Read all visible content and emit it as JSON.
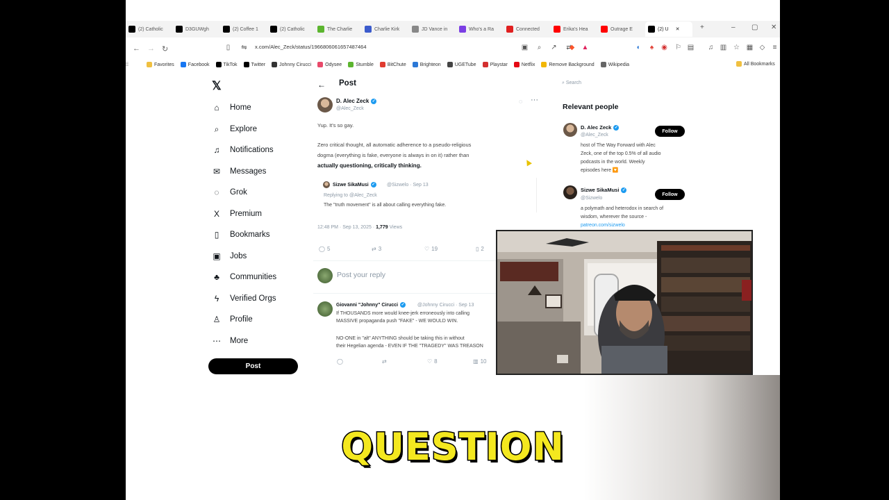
{
  "browser": {
    "tabs": [
      {
        "label": "(2) Catholic",
        "icon": "x-favicon",
        "color": "#000000"
      },
      {
        "label": "D3GUWgh",
        "icon": "x-favicon",
        "color": "#000000"
      },
      {
        "label": "(2) Coffee 1",
        "icon": "x-favicon",
        "color": "#000000"
      },
      {
        "label": "(2) Catholic",
        "icon": "x-favicon",
        "color": "#000000"
      },
      {
        "label": "The Charlie",
        "icon": "rumble-favicon",
        "color": "#5cb52f"
      },
      {
        "label": "Charlie Kirk",
        "icon": "shield-favicon",
        "color": "#3b5bcc"
      },
      {
        "label": "JD Vance in",
        "icon": "globe-favicon",
        "color": "#888888"
      },
      {
        "label": "Who's a Ra",
        "icon": "purple-favicon",
        "color": "#7b3fe4"
      },
      {
        "label": "Connected",
        "icon": "red-favicon",
        "color": "#e02020"
      },
      {
        "label": "Erika's Hea",
        "icon": "youtube-favicon",
        "color": "#ff0000"
      },
      {
        "label": "Outrage E",
        "icon": "youtube-favicon",
        "color": "#ff0000"
      },
      {
        "label": "(2) U",
        "icon": "x-favicon",
        "color": "#000000",
        "active": true
      }
    ],
    "url": "x.com/Alec_Zeck/status/1966806061657487464",
    "bookmarks": [
      {
        "label": "Favorites",
        "color": "#f0c040"
      },
      {
        "label": "Facebook",
        "color": "#1877f2"
      },
      {
        "label": "TikTok",
        "color": "#000000"
      },
      {
        "label": "Twitter",
        "color": "#000000"
      },
      {
        "label": "Johnny Cirucci",
        "color": "#333333"
      },
      {
        "label": "Odysee",
        "color": "#e84a6a"
      },
      {
        "label": "Stumble",
        "color": "#5cb52f"
      },
      {
        "label": "BitChute",
        "color": "#e03b2f"
      },
      {
        "label": "Brighteon",
        "color": "#2b78d6"
      },
      {
        "label": "UGETube",
        "color": "#444444"
      },
      {
        "label": "Playstar",
        "color": "#d32f2f"
      },
      {
        "label": "Netflix",
        "color": "#e50914"
      },
      {
        "label": "Remove Background",
        "color": "#f2b705"
      },
      {
        "label": "Wikipedia",
        "color": "#666666"
      }
    ],
    "all_bookmarks": "All Bookmarks"
  },
  "sidebar": {
    "items": [
      {
        "label": "Home",
        "icon": "home-icon",
        "glyph": "⌂"
      },
      {
        "label": "Explore",
        "icon": "search-icon",
        "glyph": "⌕"
      },
      {
        "label": "Notifications",
        "icon": "bell-icon",
        "glyph": "♫"
      },
      {
        "label": "Messages",
        "icon": "mail-icon",
        "glyph": "✉"
      },
      {
        "label": "Grok",
        "icon": "grok-icon",
        "glyph": "◌"
      },
      {
        "label": "Premium",
        "icon": "x-logo-icon",
        "glyph": "X"
      },
      {
        "label": "Bookmarks",
        "icon": "bookmark-icon",
        "glyph": "▯"
      },
      {
        "label": "Jobs",
        "icon": "briefcase-icon",
        "glyph": "▣"
      },
      {
        "label": "Communities",
        "icon": "people-icon",
        "glyph": "♣"
      },
      {
        "label": "Verified Orgs",
        "icon": "lightning-icon",
        "glyph": "ϟ"
      },
      {
        "label": "Profile",
        "icon": "person-icon",
        "glyph": "♙"
      },
      {
        "label": "More",
        "icon": "more-circle-icon",
        "glyph": "⋯"
      }
    ],
    "post_button": "Post"
  },
  "main": {
    "header": "Post",
    "tweet": {
      "author": "D. Alec Zeck",
      "handle": "@Alec_Zeck",
      "line1": "Yup. It's so gay.",
      "line2": "Zero critical thought, all automatic adherence to a pseudo-religious",
      "line3": "dogma (everything is fake, everyone is always in on it) rather than",
      "line4": "actually questioning, critically thinking.",
      "quoted": {
        "author": "Sizwe SikaMusi",
        "handle": "@Sizwelo · Sep 13",
        "replying": "Replying to @Alec_Zeck",
        "text": "The \"truth movement\" is all about calling everything fake."
      },
      "time": "12:48 PM",
      "date": "Sep 13, 2025",
      "views_count": "1,779",
      "views_label": "Views",
      "replies": "5",
      "reposts": "3",
      "likes": "19",
      "bookmarks": "2"
    },
    "reply_placeholder": "Post your reply",
    "reply": {
      "author": "Giovanni \"Johnny\" Cirucci",
      "handle": "@Johnny Cirucci · Sep 13",
      "line1": "If THOUSANDS more would knee-jerk erroneously into calling",
      "line2": "MASSIVE propaganda push \"FAKE\" - WE WOULD WIN.",
      "line3": "NO-ONE in \"alt\" ANYTHING should be taking this in without",
      "line4": "their Hegelian agenda - EVEN IF THE \"TRAGEDY\" WAS TREASON",
      "reposts": "",
      "likes": "8",
      "views": "10"
    }
  },
  "right": {
    "search_placeholder": "Search",
    "relevant_title": "Relevant people",
    "people": [
      {
        "name": "D. Alec Zeck",
        "handle": "@Alec_Zeck",
        "follow": "Follow",
        "bio1": "host of The Way Forward with Alec",
        "bio2": "Zeck, one of the top 0.5% of all audio",
        "bio3": "podcasts in the world. Weekly",
        "bio4": "episodes here 🔽"
      },
      {
        "name": "Sizwe SikaMusi",
        "handle": "@Sizwelo",
        "follow": "Follow",
        "bio1": "a polymath and heterodox in search of",
        "bio2": "wisdom, wherever the source -",
        "bio3": "patreon.com/sizwelo"
      }
    ]
  },
  "caption": "QUESTION",
  "colors": {
    "caption": "#f4e81f",
    "verified": "#1d9bf0"
  }
}
